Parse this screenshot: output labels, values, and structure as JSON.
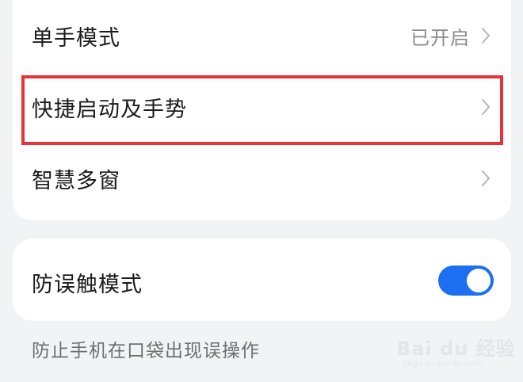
{
  "settings": {
    "items": [
      {
        "label": "单手模式",
        "value": "已开启"
      },
      {
        "label": "快捷启动及手势",
        "value": ""
      },
      {
        "label": "智慧多窗",
        "value": ""
      }
    ]
  },
  "accidental_touch": {
    "label": "防误触模式",
    "enabled": true,
    "description": "防止手机在口袋出现误操作"
  },
  "watermark": {
    "text": "Bai du 经验",
    "sub": "jingyan.baidu.com"
  },
  "colors": {
    "accent": "#1d6ff2",
    "highlight": "#e8323a",
    "background": "#f1f3f5"
  },
  "icons": {
    "chevron": "chevron-right-icon"
  }
}
